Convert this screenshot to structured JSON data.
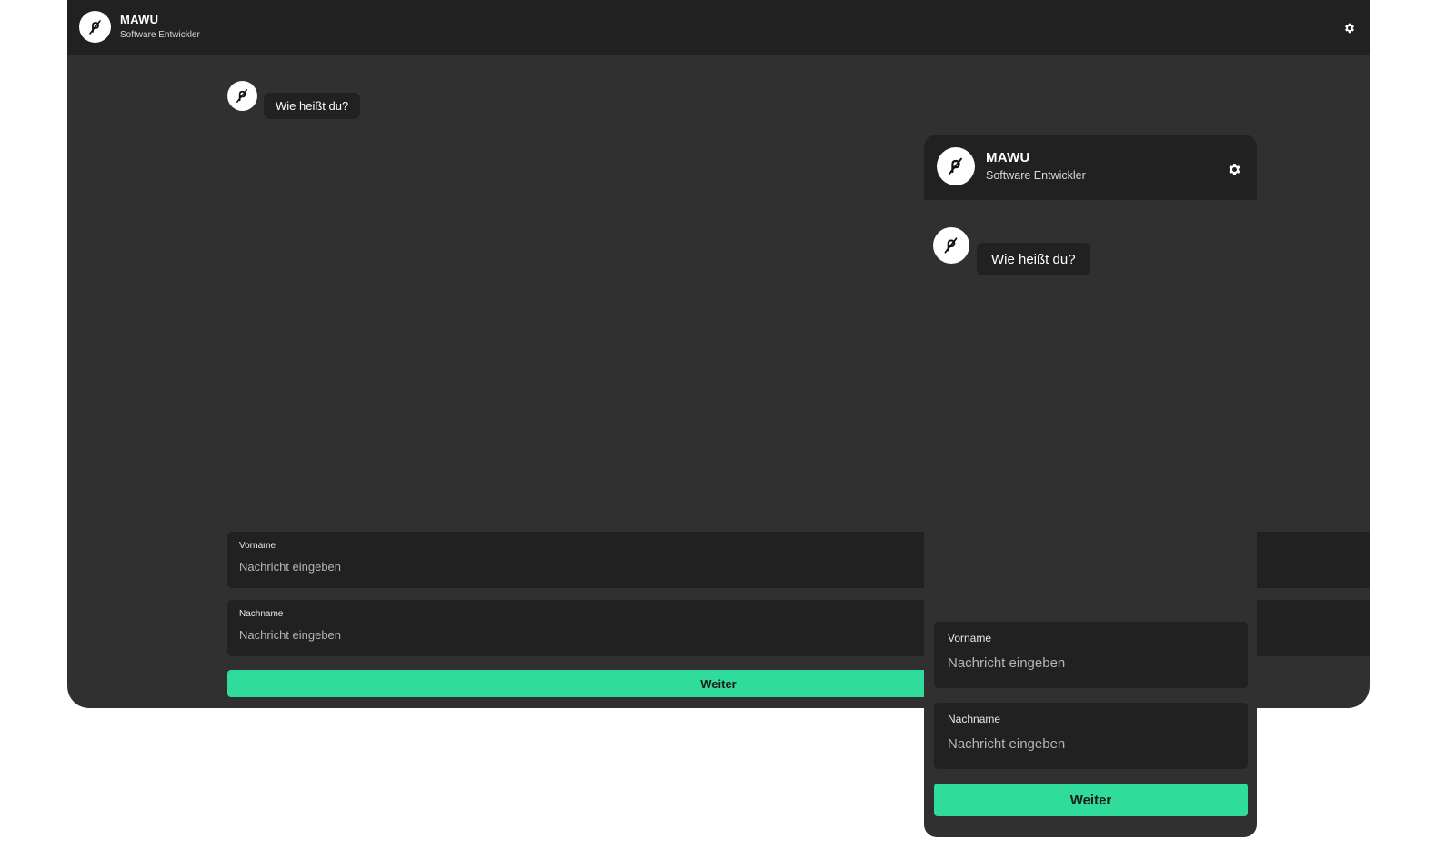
{
  "app": {
    "title": "MAWU",
    "subtitle": "Software Entwickler"
  },
  "chat": {
    "question": "Wie heißt du?"
  },
  "form": {
    "first_name_label": "Vorname",
    "last_name_label": "Nachname",
    "placeholder": "Nachricht eingeben",
    "submit_label": "Weiter"
  },
  "colors": {
    "accent": "#2fdc9c",
    "background": "#303030",
    "surface": "#212121",
    "text": "#ffffff"
  },
  "icons": {
    "logo": "not-equal-slashed-p-logo-icon",
    "settings": "gear-icon"
  }
}
